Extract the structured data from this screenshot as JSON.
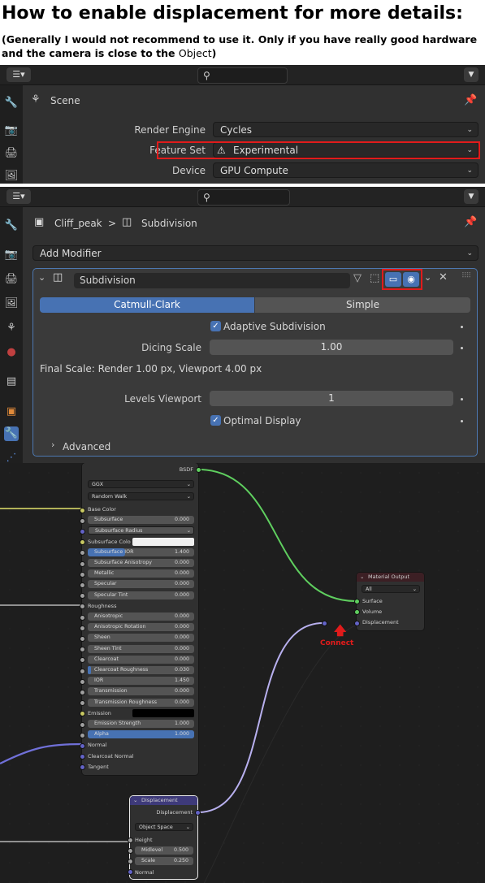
{
  "header": {
    "title": "How to enable displacement for more details:",
    "note_line1": "(Generally I would not recommend to use it. Only if you have really good hardware",
    "note_line2": "and the camera is close to the",
    "note_object": "Object",
    "note_close": ")"
  },
  "render_panel": {
    "context": "Scene",
    "rows": [
      {
        "label": "Render Engine",
        "value": "Cycles"
      },
      {
        "label": "Feature Set",
        "value": "Experimental",
        "highlighted": true
      },
      {
        "label": "Device",
        "value": "GPU Compute"
      }
    ]
  },
  "modifier_panel": {
    "breadcrumb": {
      "object": "Cliff_peak",
      "separator": ">",
      "modifier": "Subdivision"
    },
    "add_modifier": "Add Modifier",
    "modifier": {
      "name": "Subdivision",
      "tabs": [
        {
          "label": "Catmull-Clark",
          "active": true
        },
        {
          "label": "Simple",
          "active": false
        }
      ],
      "adaptive_label": "Adaptive Subdivision",
      "adaptive_checked": true,
      "dicing_scale_label": "Dicing Scale",
      "dicing_scale_value": "1.00",
      "final_scale": "Final Scale: Render 1.00 px, Viewport 4.00 px",
      "levels_viewport_label": "Levels Viewport",
      "levels_viewport_value": "1",
      "optimal_display_label": "Optimal Display",
      "optimal_display_checked": true,
      "advanced_label": "Advanced"
    }
  },
  "node_editor": {
    "bsdf": {
      "output_label": "BSDF",
      "distribution": "GGX",
      "subsurface_method": "Random Walk",
      "inputs": [
        {
          "label": "Base Color",
          "type": "socket"
        },
        {
          "label": "Subsurface",
          "value": "0.000"
        },
        {
          "label": "Subsurface Radius",
          "type": "dropdown"
        },
        {
          "label": "Subsurface Colo",
          "type": "color",
          "color": "#f0f0f0"
        },
        {
          "label": "Subsurface IOR",
          "value": "1.400",
          "fill": 0.35
        },
        {
          "label": "Subsurface Anisotropy",
          "value": "0.000"
        },
        {
          "label": "Metallic",
          "value": "0.000"
        },
        {
          "label": "Specular",
          "value": "0.000"
        },
        {
          "label": "Specular Tint",
          "value": "0.000"
        },
        {
          "label": "Roughness",
          "type": "socket"
        },
        {
          "label": "Anisotropic",
          "value": "0.000"
        },
        {
          "label": "Anisotropic Rotation",
          "value": "0.000"
        },
        {
          "label": "Sheen",
          "value": "0.000"
        },
        {
          "label": "Sheen Tint",
          "value": "0.000"
        },
        {
          "label": "Clearcoat",
          "value": "0.000"
        },
        {
          "label": "Clearcoat Roughness",
          "value": "0.030",
          "fill": 0.03
        },
        {
          "label": "IOR",
          "value": "1.450"
        },
        {
          "label": "Transmission",
          "value": "0.000"
        },
        {
          "label": "Transmission Roughness",
          "value": "0.000"
        },
        {
          "label": "Emission",
          "type": "color",
          "color": "#000000"
        },
        {
          "label": "Emission Strength",
          "value": "1.000"
        },
        {
          "label": "Alpha",
          "value": "1.000",
          "fill": 1.0
        },
        {
          "label": "Normal",
          "type": "socket"
        },
        {
          "label": "Clearcoat Normal",
          "type": "socket"
        },
        {
          "label": "Tangent",
          "type": "socket"
        }
      ]
    },
    "material_output": {
      "title": "Material Output",
      "target": "All",
      "inputs": [
        "Surface",
        "Volume",
        "Displacement"
      ]
    },
    "displacement": {
      "title": "Displacement",
      "output_label": "Displacement",
      "space": "Object Space",
      "inputs": [
        {
          "label": "Height"
        },
        {
          "label": "Midlevel",
          "value": "0.500"
        },
        {
          "label": "Scale",
          "value": "0.250"
        },
        {
          "label": "Normal"
        }
      ]
    },
    "annotation": {
      "text": "Connect",
      "color": "#e01b1b"
    }
  },
  "colors": {
    "accent": "#4772b3",
    "highlight": "#e01b1b",
    "link_green": "#5fcf5f",
    "link_purple": "#b8b0ef"
  }
}
